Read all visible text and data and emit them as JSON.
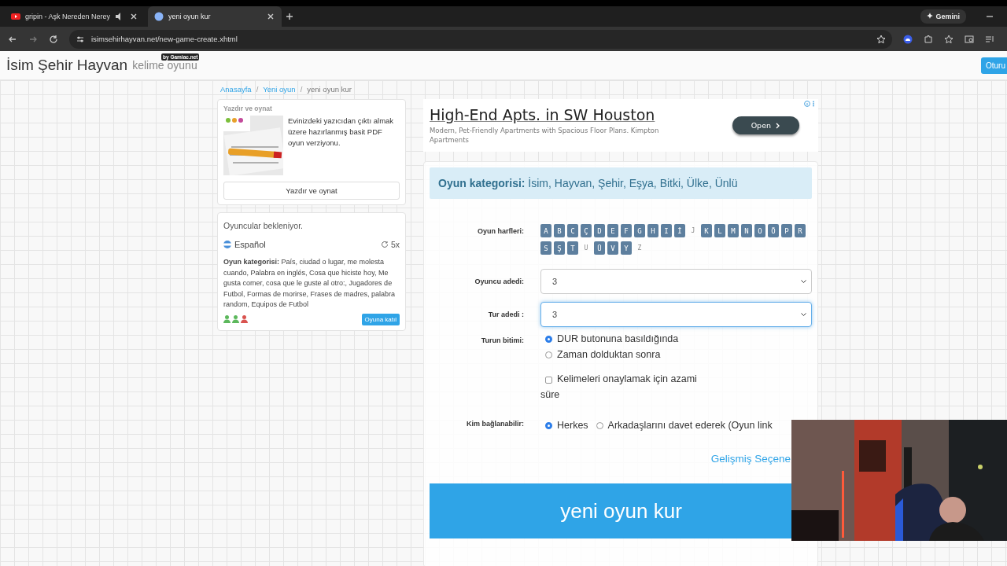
{
  "browser": {
    "tabs": [
      {
        "title": "gripin - Aşk Nereden Nerey",
        "audio": true,
        "selected": false
      },
      {
        "title": "yeni oyun kur",
        "audio": false,
        "selected": true
      }
    ],
    "url_host": "isimsehirhayvan.net",
    "url_path": "/new-game-create.xhtml",
    "gemini": "Gemini"
  },
  "header": {
    "title": "İsim Şehir Hayvan",
    "subtitle": "kelime oyunu",
    "badge": "by Gamiac.net",
    "login": "Oturu"
  },
  "breadcrumb": [
    {
      "label": "Anasayfa",
      "kind": "link"
    },
    {
      "label": "/",
      "kind": "separator"
    },
    {
      "label": "Yeni oyun",
      "kind": "link"
    },
    {
      "label": "/",
      "kind": "separator"
    },
    {
      "label": "yeni oyun kur",
      "kind": "current"
    }
  ],
  "print_card": {
    "title": "Yazdır ve oynat",
    "text": "Evinizdeki yazıcıdan çıktı almak üzere hazırlanmış basit PDF oyun verziyonu.",
    "button": "Yazdır ve oynat"
  },
  "waiting": {
    "title": "Oyuncular bekleniyor.",
    "games": [
      {
        "language": "Español",
        "rounds": "5x",
        "category_label": "Oyun kategorisi:",
        "categories": "País, ciudad o lugar, me molesta cuando, Palabra en inglés, Cosa que hiciste hoy, Me gusta comer, cosa que le guste al otro:, Jugadores de Futbol, Formas de morirse, Frases de madres, palabra random, Equipos de Futbol",
        "players": [
          {
            "color": "#5cb85c"
          },
          {
            "color": "#5cb85c"
          },
          {
            "color": "#d9534f"
          }
        ],
        "join": "Oyuna katıl"
      }
    ]
  },
  "ad": {
    "headline": "High-End Apts. in SW Houston",
    "text": "Modern, Pet-Friendly Apartments with Spacious Floor Plans. Kimpton Apartments",
    "button": "Open"
  },
  "form": {
    "category_label": "Oyun kategorisi:",
    "categories": "İsim, Hayvan, Şehir, Eşya, Bitki, Ülke, Ünlü",
    "letters_label": "Oyun harfleri:",
    "letters": [
      {
        "char": "A",
        "selected": true
      },
      {
        "char": "B",
        "selected": true
      },
      {
        "char": "C",
        "selected": true
      },
      {
        "char": "Ç",
        "selected": true
      },
      {
        "char": "D",
        "selected": true
      },
      {
        "char": "E",
        "selected": true
      },
      {
        "char": "F",
        "selected": true
      },
      {
        "char": "G",
        "selected": true
      },
      {
        "char": "H",
        "selected": true
      },
      {
        "char": "I",
        "selected": true
      },
      {
        "char": "İ",
        "selected": true
      },
      {
        "char": "J",
        "selected": false
      },
      {
        "char": "K",
        "selected": true
      },
      {
        "char": "L",
        "selected": true
      },
      {
        "char": "M",
        "selected": true
      },
      {
        "char": "N",
        "selected": true
      },
      {
        "char": "O",
        "selected": true
      },
      {
        "char": "Ö",
        "selected": true
      },
      {
        "char": "P",
        "selected": true
      },
      {
        "char": "R",
        "selected": true
      },
      {
        "char": "S",
        "selected": true
      },
      {
        "char": "Ş",
        "selected": true
      },
      {
        "char": "T",
        "selected": true
      },
      {
        "char": "U",
        "selected": false
      },
      {
        "char": "Ü",
        "selected": true
      },
      {
        "char": "V",
        "selected": true
      },
      {
        "char": "Y",
        "selected": true
      },
      {
        "char": "Z",
        "selected": false
      }
    ],
    "players_label": "Oyuncu adedi:",
    "players_value": "3",
    "rounds_label": "Tur adedi :",
    "rounds_value": "3",
    "rounds_focused": true,
    "end_label": "Turun bitimi:",
    "end_options": [
      {
        "label": "DUR butonuna basıldığında",
        "selected": true
      },
      {
        "label": "Zaman dolduktan sonra",
        "selected": false
      }
    ],
    "confirm_limit": {
      "label": "Kelimeleri onaylamak için azami süre",
      "checked": false
    },
    "access_label": "Kim bağlanabilir:",
    "access_options": [
      {
        "label": "Herkes",
        "selected": true
      },
      {
        "label": "Arkadaşlarını davet ederek (Oyun link",
        "selected": false
      }
    ],
    "advanced": "Gelişmiş Seçene",
    "submit": "yeni oyun kur"
  }
}
